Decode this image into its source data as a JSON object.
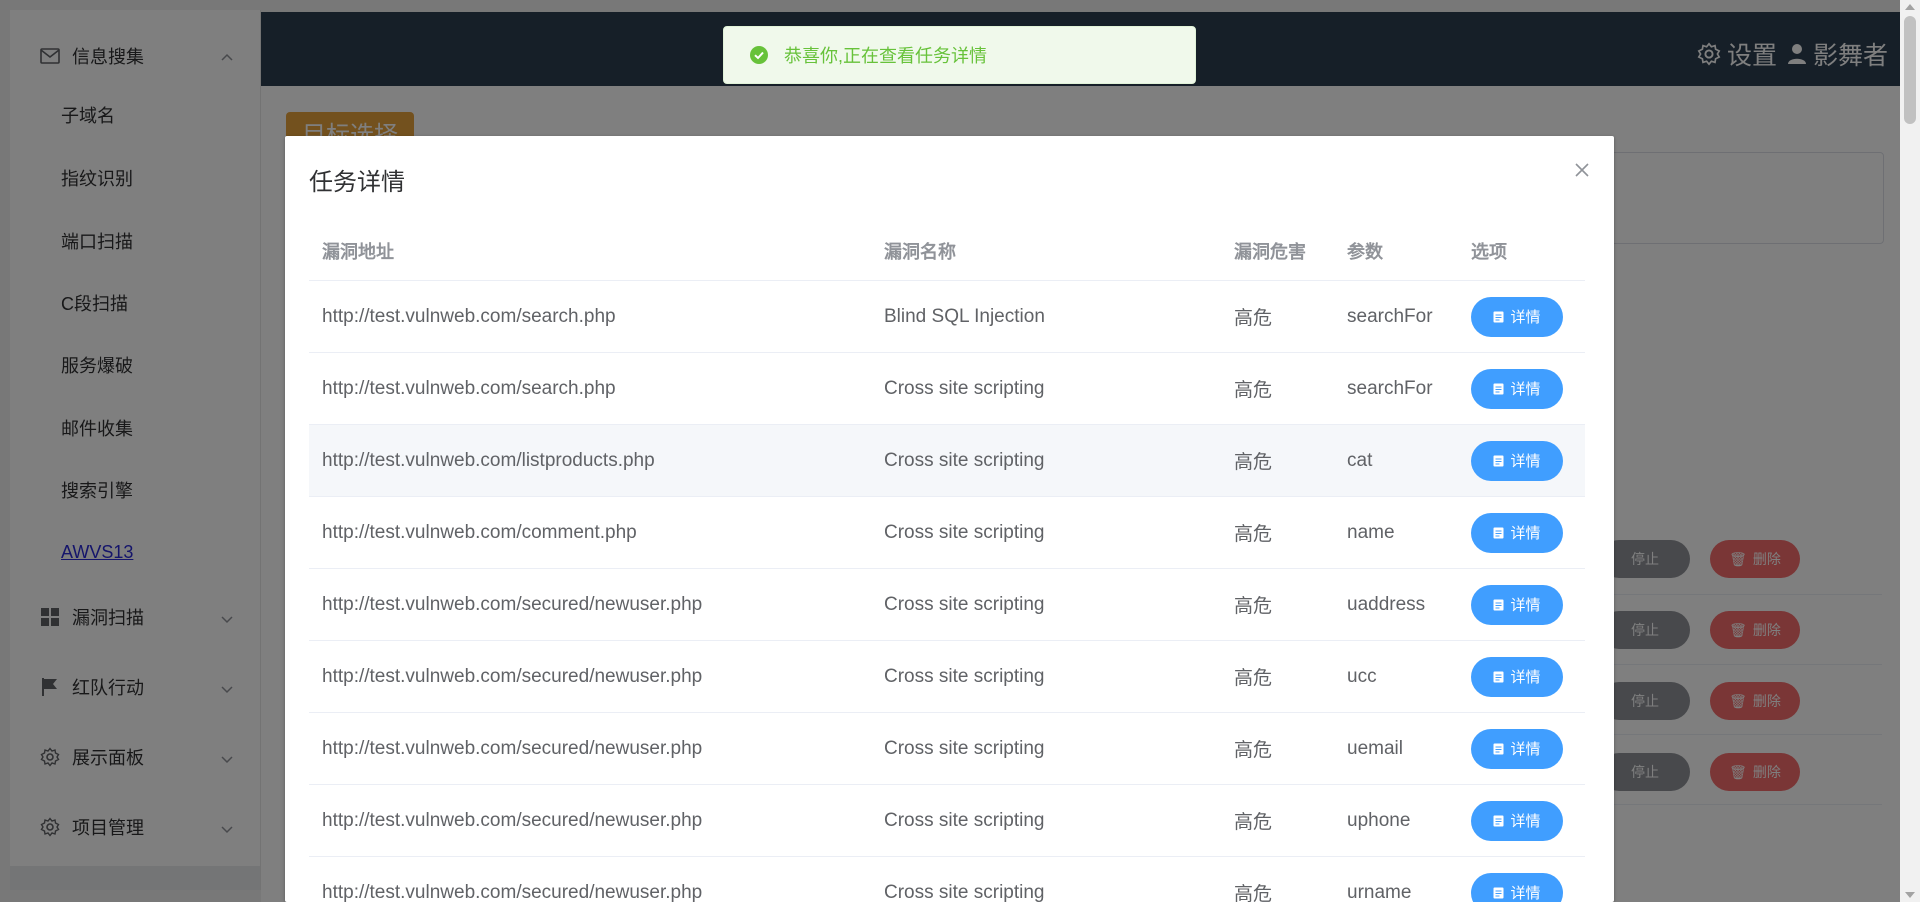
{
  "sidebar": {
    "groups": [
      {
        "label": "信息搜集",
        "icon": "mail-icon",
        "expanded": true
      },
      {
        "label": "漏洞扫描",
        "icon": "grid-icon"
      },
      {
        "label": "红队行动",
        "icon": "flag-icon"
      },
      {
        "label": "展示面板",
        "icon": "gear-icon"
      },
      {
        "label": "项目管理",
        "icon": "gear-icon"
      }
    ],
    "sub_items": [
      "子域名",
      "指纹识别",
      "端口扫描",
      "C段扫描",
      "服务爆破",
      "邮件收集",
      "搜索引擎",
      "AWVS13"
    ],
    "active_sub": "AWVS13"
  },
  "header": {
    "settings_label": "设置",
    "user_label": "影舞者"
  },
  "page": {
    "target_tag": "目标选择",
    "stop_label": "停止",
    "delete_label": "删除"
  },
  "toast": {
    "message": "恭喜你,正在查看任务详情",
    "type": "success"
  },
  "dialog": {
    "title": "任务详情",
    "columns": [
      "漏洞地址",
      "漏洞名称",
      "漏洞危害",
      "参数",
      "选项"
    ],
    "detail_label": "详情",
    "rows": [
      {
        "url": "http://test.vulnweb.com/search.php",
        "name": "Blind SQL Injection",
        "severity": "高危",
        "param": "searchFor"
      },
      {
        "url": "http://test.vulnweb.com/search.php",
        "name": "Cross site scripting",
        "severity": "高危",
        "param": "searchFor"
      },
      {
        "url": "http://test.vulnweb.com/listproducts.php",
        "name": "Cross site scripting",
        "severity": "高危",
        "param": "cat"
      },
      {
        "url": "http://test.vulnweb.com/comment.php",
        "name": "Cross site scripting",
        "severity": "高危",
        "param": "name"
      },
      {
        "url": "http://test.vulnweb.com/secured/newuser.php",
        "name": "Cross site scripting",
        "severity": "高危",
        "param": "uaddress"
      },
      {
        "url": "http://test.vulnweb.com/secured/newuser.php",
        "name": "Cross site scripting",
        "severity": "高危",
        "param": "ucc"
      },
      {
        "url": "http://test.vulnweb.com/secured/newuser.php",
        "name": "Cross site scripting",
        "severity": "高危",
        "param": "uemail"
      },
      {
        "url": "http://test.vulnweb.com/secured/newuser.php",
        "name": "Cross site scripting",
        "severity": "高危",
        "param": "uphone"
      },
      {
        "url": "http://test.vulnweb.com/secured/newuser.php",
        "name": "Cross site scripting",
        "severity": "高危",
        "param": "urname"
      }
    ]
  },
  "colors": {
    "primary": "#409eff",
    "success": "#67c23a",
    "warning": "#e6a23c",
    "danger": "#f56c6c",
    "info": "#909399",
    "header_bg": "#2c3e50"
  }
}
